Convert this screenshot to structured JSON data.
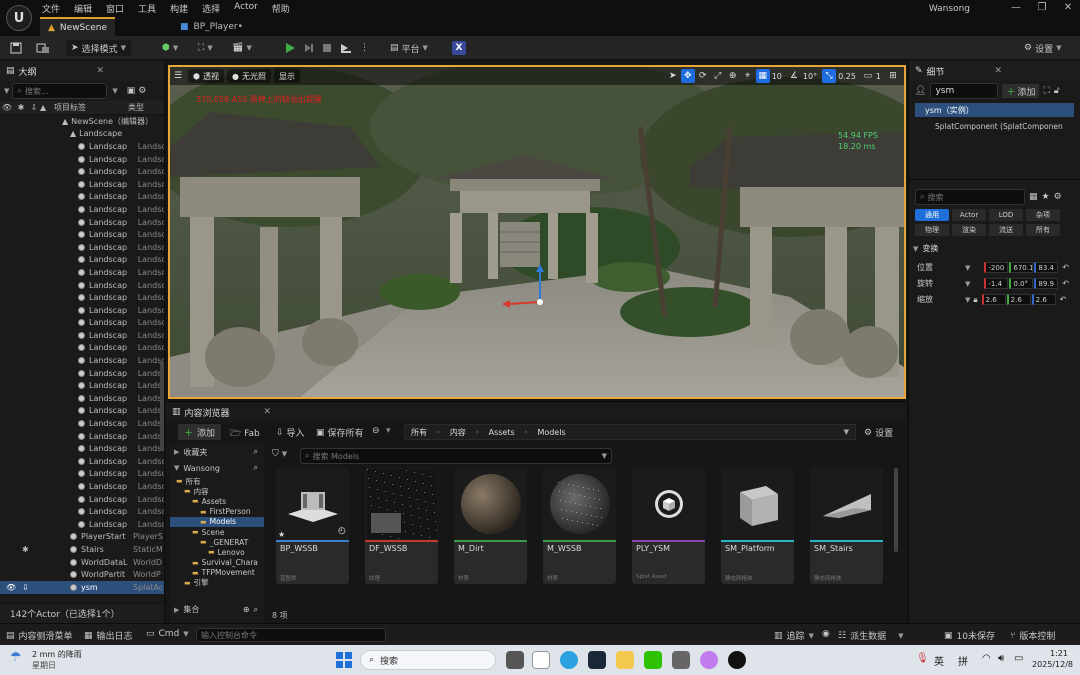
{
  "titlebar": {
    "menu": [
      "文件",
      "编辑",
      "窗口",
      "工具",
      "构建",
      "选择",
      "Actor",
      "帮助"
    ],
    "tabs": [
      {
        "label": "NewScene"
      },
      {
        "label": "BP_Player•"
      }
    ],
    "user": "Wansong"
  },
  "toolbar": {
    "mode_label": "选择模式",
    "platform_label": "平台",
    "settings_label": "设置"
  },
  "outliner": {
    "title": "大纲",
    "search_placeholder": "搜索...",
    "col_label": "项目标签",
    "col_type": "类型",
    "scene_label": "NewScene（编辑器）",
    "landscape_label": "Landscape",
    "landscape_row_name": "Landscap",
    "landscape_row_type": "Landsc",
    "bottom_rows": [
      {
        "name": "PlayerStart",
        "type": "PlayerS"
      },
      {
        "name": "Stairs",
        "type": "StaticM"
      },
      {
        "name": "WorldDataL",
        "type": "WorldD"
      },
      {
        "name": "WorldPartit",
        "type": "WorldP"
      },
      {
        "name": "ysm",
        "type": "SplatAc"
      }
    ],
    "footer": "142个Actor（已选择1个）"
  },
  "viewport": {
    "perspective": "透视",
    "lighting": "无光照",
    "show": "显示",
    "grid_value": "10",
    "angle_value": "10°",
    "scale_value": "0.25",
    "camera_value": "1",
    "warning": "370,058 ASS 原神上的缺溢出提醒",
    "fps": "54.94 FPS",
    "ms": "18.20 ms"
  },
  "details": {
    "title": "细节",
    "actor_name": "ysm",
    "add_label": "添加",
    "instance_label": "ysm（实例）",
    "component_label": "SplatComponent (SplatComponen",
    "search_placeholder": "搜索",
    "chips_row1": [
      "通用",
      "Actor",
      "LOD",
      "杂项"
    ],
    "chips_row2": [
      "物理",
      "渲染",
      "流送",
      "所有"
    ],
    "section_transform": "变换",
    "location": {
      "label": "位置",
      "x": "-200",
      "y": "670.1",
      "z": "83.4"
    },
    "rotation": {
      "label": "旋转",
      "x": "-1.4",
      "y": "0.0°",
      "z": "89.9"
    },
    "scale": {
      "label": "缩放",
      "x": "2.6",
      "y": "2.6",
      "z": "2.6"
    }
  },
  "content_browser": {
    "title": "内容浏览器",
    "add_label": "添加",
    "fab_label": "Fab",
    "import_label": "导入",
    "save_all_label": "保存所有",
    "breadcrumb": [
      "所有",
      "内容",
      "Assets",
      "Models"
    ],
    "settings_label": "设置",
    "favorites_label": "收藏夹",
    "project_label": "Wansong",
    "search_placeholder": "搜索 Models",
    "tree": [
      {
        "label": "所有",
        "indent": 0
      },
      {
        "label": "内容",
        "indent": 1
      },
      {
        "label": "Assets",
        "indent": 2
      },
      {
        "label": "FirstPerson",
        "indent": 3
      },
      {
        "label": "Models",
        "indent": 3,
        "selected": true
      },
      {
        "label": "Scene",
        "indent": 2
      },
      {
        "label": "_GENERAT",
        "indent": 3
      },
      {
        "label": "Lenovo",
        "indent": 4
      },
      {
        "label": "Survival_Chara",
        "indent": 2
      },
      {
        "label": "TFPMovement",
        "indent": 2
      },
      {
        "label": "引擎",
        "indent": 1
      }
    ],
    "collections_label": "集合",
    "item_count": "8 项",
    "assets": [
      {
        "name": "BP_WSSB",
        "type": "蓝图类",
        "color": "#3d7fd0"
      },
      {
        "name": "DF_WSSB",
        "type": "纹理",
        "color": "#c0392b"
      },
      {
        "name": "M_Dirt",
        "type": "材质",
        "color": "#3a9a4a"
      },
      {
        "name": "M_WSSB",
        "type": "材质",
        "color": "#3a9a4a"
      },
      {
        "name": "PLY_YSM",
        "type": "Splat Asset",
        "color": "#8e44ad"
      },
      {
        "name": "SM_Platform",
        "type": "静态网格体",
        "color": "#2bb5c9"
      },
      {
        "name": "SM_Stairs",
        "type": "静态网格体",
        "color": "#2bb5c9"
      }
    ]
  },
  "statusbar": {
    "content_drawer": "内容侧滑菜单",
    "output_log": "输出日志",
    "cmd": "Cmd",
    "console_placeholder": "输入控制台命令",
    "trace": "追踪",
    "derived_data": "派生数据",
    "unsaved": "10未保存",
    "source_control": "版本控制"
  },
  "taskbar": {
    "weather_temp": "2 mm 的降雨",
    "weather_day": "星期日",
    "search_label": "搜索",
    "ime1": "英",
    "ime2": "拼",
    "time": "1:21",
    "date": "2025/12/8"
  }
}
